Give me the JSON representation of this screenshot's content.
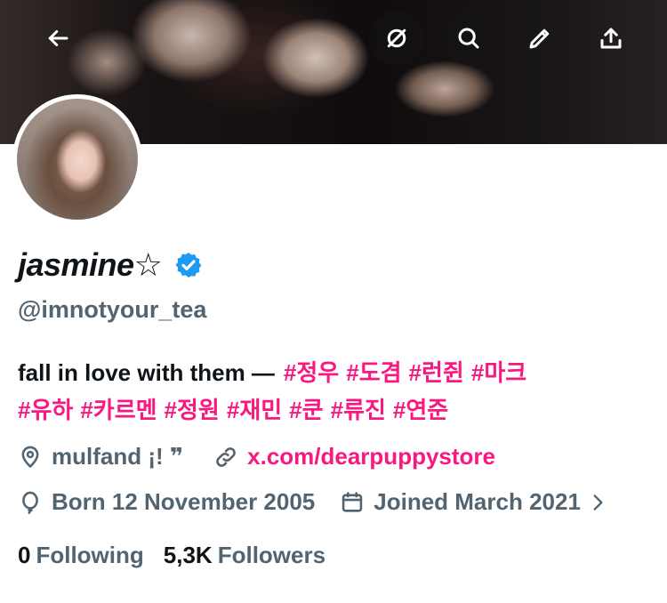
{
  "header": {
    "back_icon": "arrow-left-icon",
    "actions": [
      {
        "icon": "grok-icon"
      },
      {
        "icon": "search-icon"
      },
      {
        "icon": "edit-icon"
      },
      {
        "icon": "share-icon"
      }
    ]
  },
  "profile": {
    "display_name": "jasmine☆",
    "verified": true,
    "verified_color": "#1d9bf0",
    "handle": "@imnotyour_tea",
    "bio_text": "fall in love with them —",
    "bio_hashtags": [
      "#정우",
      "#도겸",
      "#런쥔",
      "#마크",
      "#유하",
      "#카르멘",
      "#정원",
      "#재민",
      "#쿤",
      "#류진",
      "#연준"
    ],
    "location": "mulfand ¡! ❞",
    "website": "x.com/dearpuppystore",
    "birthday": "Born 12 November 2005",
    "joined": "Joined March 2021",
    "following_count": "0",
    "following_label": "Following",
    "followers_count": "5,3K",
    "followers_label": "Followers"
  },
  "colors": {
    "accent_pink": "#f91880",
    "secondary_text": "#536471",
    "primary_text": "#0f1419"
  }
}
